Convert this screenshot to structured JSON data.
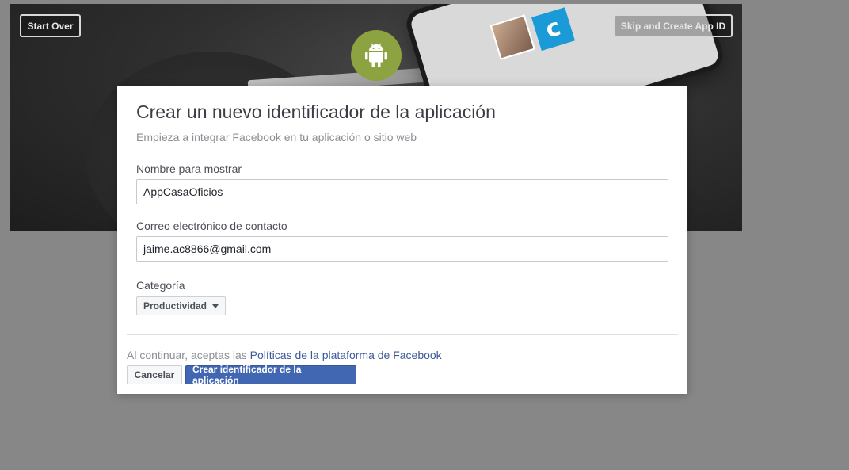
{
  "header": {
    "start_over_label": "Start Over",
    "skip_label": "Skip and Create App ID",
    "platform_icon": "android-icon"
  },
  "modal": {
    "title": "Crear un nuevo identificador de la aplicación",
    "subtitle": "Empieza a integrar Facebook en tu aplicación o sitio web",
    "fields": {
      "display_name_label": "Nombre para mostrar",
      "display_name_value": "AppCasaOficios",
      "contact_email_label": "Correo electrónico de contacto",
      "contact_email_value": "jaime.ac8866@gmail.com",
      "category_label": "Categoría",
      "category_value": "Productividad"
    },
    "policy": {
      "prefix": "Al continuar, aceptas las",
      "link_text": "Políticas de la plataforma de Facebook"
    },
    "buttons": {
      "cancel_label": "Cancelar",
      "create_label": "Crear identificador de la aplicación"
    }
  },
  "colors": {
    "primary": "#4267b2",
    "android_badge": "#8da341",
    "link": "#3b5998"
  }
}
